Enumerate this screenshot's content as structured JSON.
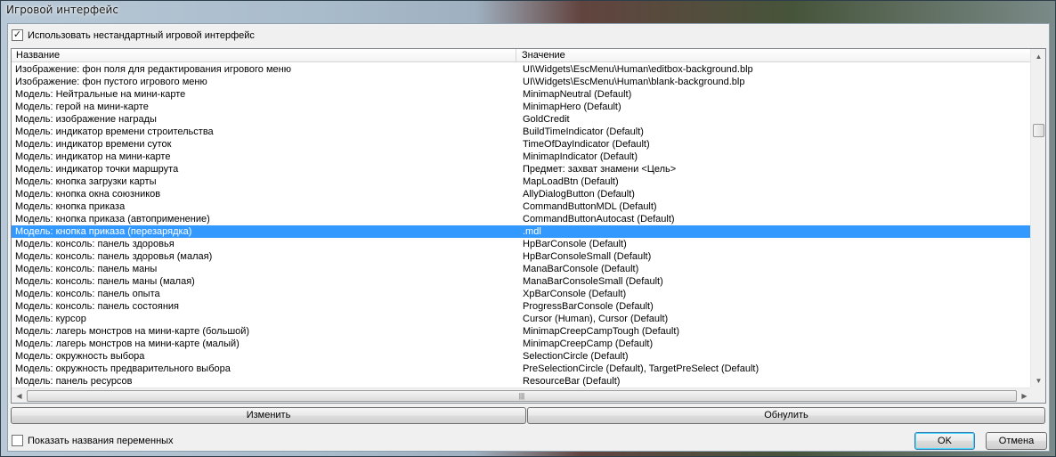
{
  "window": {
    "title": "Игровой интерфейс"
  },
  "use_custom": {
    "label": "Использовать нестандартный игровой интерфейс",
    "checked": true,
    "mark": "✓"
  },
  "table": {
    "headers": {
      "name": "Название",
      "value": "Значение"
    },
    "selected_index": 13,
    "rows": [
      {
        "name": "Изображение: фон поля для редактирования игрового меню",
        "value": "UI\\Widgets\\EscMenu\\Human\\editbox-background.blp"
      },
      {
        "name": "Изображение: фон пустого игрового меню",
        "value": "UI\\Widgets\\EscMenu\\Human\\blank-background.blp"
      },
      {
        "name": "Модель: Нейтральные на мини-карте",
        "value": "MinimapNeutral (Default)"
      },
      {
        "name": "Модель: герой на мини-карте",
        "value": "MinimapHero (Default)"
      },
      {
        "name": "Модель: изображение награды",
        "value": "GoldCredit"
      },
      {
        "name": "Модель: индикатор времени строительства",
        "value": "BuildTimeIndicator (Default)"
      },
      {
        "name": "Модель: индикатор времени суток",
        "value": "TimeOfDayIndicator (Default)"
      },
      {
        "name": "Модель: индикатор на мини-карте",
        "value": "MinimapIndicator (Default)"
      },
      {
        "name": "Модель: индикатор точки маршрута",
        "value": "Предмет: захват знамени <Цель>"
      },
      {
        "name": "Модель: кнопка загрузки карты",
        "value": "MapLoadBtn (Default)"
      },
      {
        "name": "Модель: кнопка окна союзников",
        "value": "AllyDialogButton (Default)"
      },
      {
        "name": "Модель: кнопка приказа",
        "value": "CommandButtonMDL (Default)"
      },
      {
        "name": "Модель: кнопка приказа (автоприменение)",
        "value": "CommandButtonAutocast (Default)"
      },
      {
        "name": "Модель: кнопка приказа (перезарядка)",
        "value": ".mdl"
      },
      {
        "name": "Модель: консоль: панель здоровья",
        "value": "HpBarConsole (Default)"
      },
      {
        "name": "Модель: консоль: панель здоровья (малая)",
        "value": "HpBarConsoleSmall (Default)"
      },
      {
        "name": "Модель: консоль: панель маны",
        "value": "ManaBarConsole (Default)"
      },
      {
        "name": "Модель: консоль: панель маны (малая)",
        "value": "ManaBarConsoleSmall (Default)"
      },
      {
        "name": "Модель: консоль: панель опыта",
        "value": "XpBarConsole (Default)"
      },
      {
        "name": "Модель: консоль: панель состояния",
        "value": "ProgressBarConsole (Default)"
      },
      {
        "name": "Модель: курсор",
        "value": "Cursor (Human), Cursor (Default)"
      },
      {
        "name": "Модель: лагерь монстров на мини-карте (большой)",
        "value": "MinimapCreepCampTough (Default)"
      },
      {
        "name": "Модель: лагерь монстров на мини-карте (малый)",
        "value": "MinimapCreepCamp (Default)"
      },
      {
        "name": "Модель: окружность выбора",
        "value": "SelectionCircle (Default)"
      },
      {
        "name": "Модель: окружность предварительного выбора",
        "value": "PreSelectionCircle (Default), TargetPreSelect (Default)"
      },
      {
        "name": "Модель: панель ресурсов",
        "value": "ResourceBar (Default)"
      }
    ]
  },
  "scrollbars": {
    "up_glyph": "▲",
    "down_glyph": "▼",
    "left_glyph": "◀",
    "right_glyph": "▶",
    "grip_glyph": "|||"
  },
  "buttons": {
    "change": "Изменить",
    "reset": "Обнулить",
    "ok": "OK",
    "cancel": "Отмена"
  },
  "show_var_names": {
    "label": "Показать названия переменных",
    "checked": false
  }
}
